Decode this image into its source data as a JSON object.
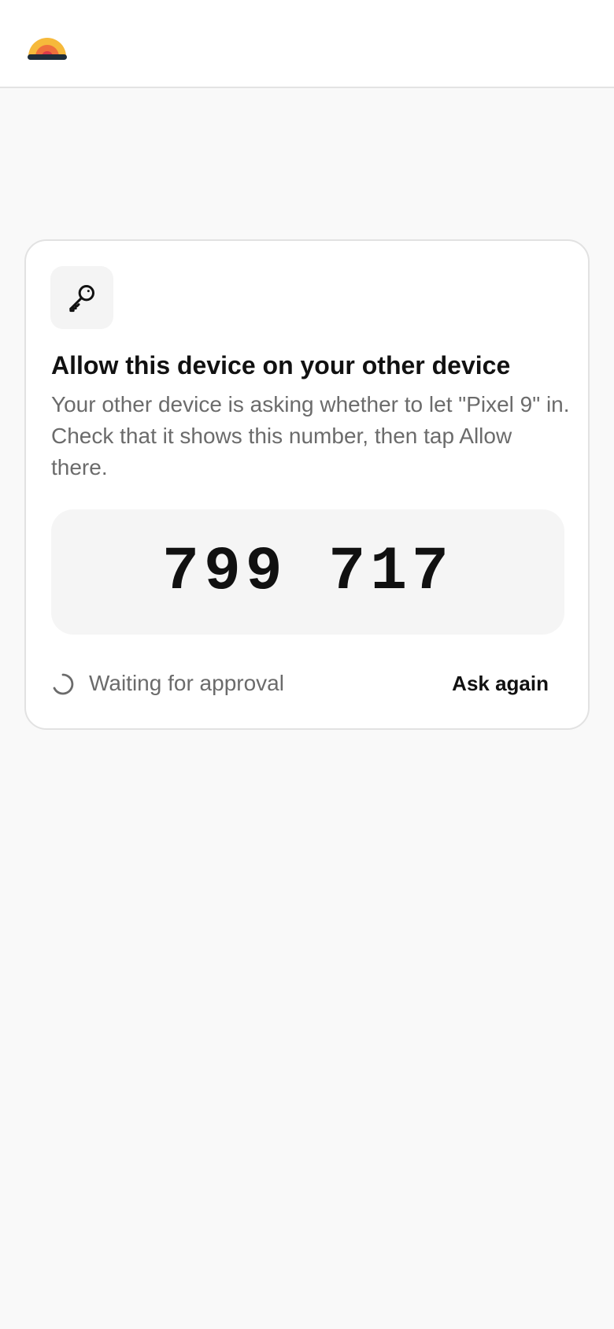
{
  "header": {
    "logo_icon": "sunset-logo-icon"
  },
  "card": {
    "icon": "key-icon",
    "title": "Allow this device on your other device",
    "description": "Your other device is asking whether to let \"Pixel 9\" in. Check that it shows this number, then tap Allow there.",
    "code": "799 717",
    "status": {
      "icon": "spinner-icon",
      "text": "Waiting for approval"
    },
    "ask_again_label": "Ask again"
  },
  "colors": {
    "background": "#f9f9f9",
    "card": "#ffffff",
    "muted_text": "#6b6b6b",
    "primary_text": "#111111",
    "logo_yellow": "#f6b93b",
    "logo_orange": "#ef6f3c",
    "logo_red": "#d93a4a",
    "logo_base": "#1f2d3a"
  }
}
